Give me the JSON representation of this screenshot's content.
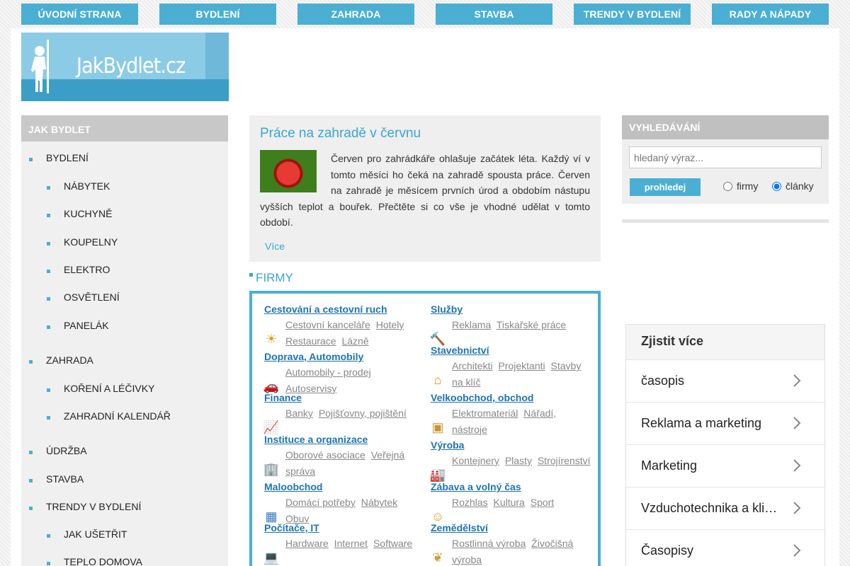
{
  "nav": [
    "ÚVODNÍ STRANA",
    "BYDLENÍ",
    "ZAHRADA",
    "STAVBA",
    "TRENDY V BYDLENÍ",
    "RADY A NÁPADY"
  ],
  "logo": {
    "text": "JakBydlet.cz"
  },
  "sidebar": {
    "title": "JAK BYDLET",
    "items": [
      {
        "label": "BYDLENÍ",
        "level": 1
      },
      {
        "label": "NÁBYTEK",
        "level": 2
      },
      {
        "label": "KUCHYNĚ",
        "level": 2
      },
      {
        "label": "KOUPELNY",
        "level": 2
      },
      {
        "label": "ELEKTRO",
        "level": 2
      },
      {
        "label": "OSVĚTLENÍ",
        "level": 2
      },
      {
        "label": "PANELÁK",
        "level": 2
      },
      {
        "label": "ZAHRADA",
        "level": 1
      },
      {
        "label": "KOŘENÍ A LÉČIVKY",
        "level": 2
      },
      {
        "label": "ZAHRADNÍ KALENDÁŘ",
        "level": 2
      },
      {
        "label": "ÚDRŽBA",
        "level": 1
      },
      {
        "label": "STAVBA",
        "level": 1
      },
      {
        "label": "TRENDY V BYDLENÍ",
        "level": 1
      },
      {
        "label": "JAK UŠETŘIT",
        "level": 2
      },
      {
        "label": "TEPLO DOMOVA",
        "level": 2
      }
    ]
  },
  "article": {
    "title": "Práce na zahradě v červnu",
    "text": "Červen pro zahrádkáře ohlašuje začátek léta. Každý ví v tomto měsíci ho čeká na zahradě spousta práce. Červen na zahradě je měsícem prvních úrod a obdobím nástupu vyšších teplot a bouřek. Přečtěte si co vše je vhodné udělat v tomto období.",
    "more": "Více"
  },
  "firmy": {
    "title": "FIRMY",
    "left": [
      {
        "title": "Cestování a cestovní ruch",
        "icon": "sun-icon",
        "links": [
          "Cestovní kanceláře",
          "Hotely",
          "Restaurace",
          "Lázně"
        ]
      },
      {
        "title": "Doprava, Automobily",
        "icon": "car-icon",
        "links": [
          "Automobily - prodej",
          "Autoservisy"
        ]
      },
      {
        "title": "Finance",
        "icon": "chart-icon",
        "links": [
          "Banky",
          "Pojišťovny, pojištění"
        ]
      },
      {
        "title": "Instituce a organizace",
        "icon": "building-icon",
        "links": [
          "Oborové asociace",
          "Veřejná správa"
        ]
      },
      {
        "title": "Maloobchod",
        "icon": "phone-icon",
        "links": [
          "Domácí potřeby",
          "Nábytek",
          "Obuv"
        ]
      },
      {
        "title": "Počítače, IT",
        "icon": "computer-icon",
        "links": [
          "Hardware",
          "Internet",
          "Software"
        ]
      }
    ],
    "right": [
      {
        "title": "Služby",
        "icon": "hammer-icon",
        "links": [
          "Reklama",
          "Tiskařské práce"
        ]
      },
      {
        "title": "Stavebnictví",
        "icon": "house-icon",
        "links": [
          "Architekti",
          "Projektanti",
          "Stavby na klíč"
        ]
      },
      {
        "title": "Velkoobchod, obchod",
        "icon": "boxes-icon",
        "links": [
          "Elektromateriál",
          "Nářadí, nástroje"
        ]
      },
      {
        "title": "Výroba",
        "icon": "factory-icon",
        "links": [
          "Kontejnery",
          "Plasty",
          "Strojírenství"
        ]
      },
      {
        "title": "Zábava a volný čas",
        "icon": "sunglasses-icon",
        "links": [
          "Rozhlas",
          "Kultura",
          "Sport"
        ]
      },
      {
        "title": "Zemědělství",
        "icon": "wheat-icon",
        "links": [
          "Rostlinná výroba",
          "Živočišná výroba"
        ]
      }
    ]
  },
  "search": {
    "title": "VYHLEDÁVÁNÍ",
    "placeholder": "hledaný výraz...",
    "button": "prohledej",
    "radio_firmy": "firmy",
    "radio_clanky": "články",
    "selected": "články"
  },
  "learn_more": {
    "title": "Zjistit více",
    "items": [
      "časopis",
      "Reklama a marketing",
      "Marketing",
      "Vzduchotechnika a klimatizace",
      "Časopisy"
    ]
  },
  "colors": {
    "accent": "#4aafd3",
    "link": "#1d73b3",
    "title": "#3aa6d0"
  }
}
